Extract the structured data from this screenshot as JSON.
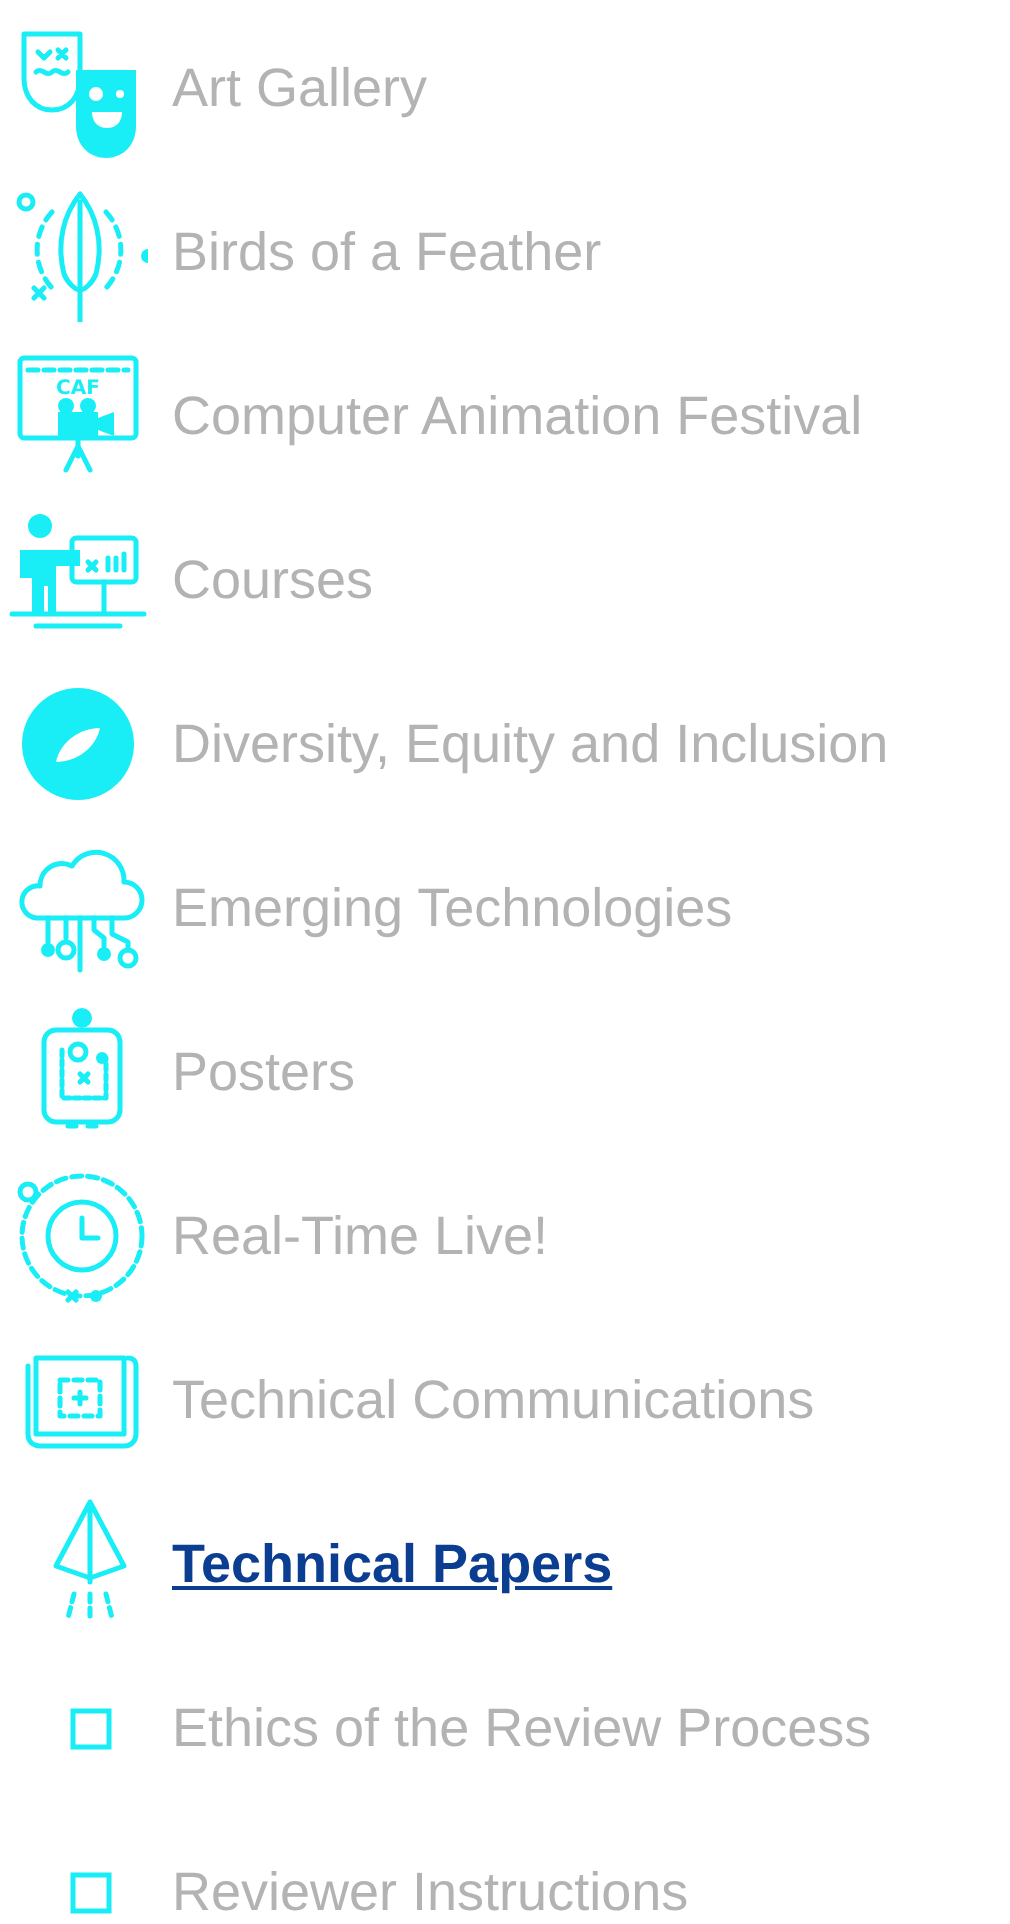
{
  "menu": [
    {
      "label": "Art Gallery",
      "kind": "section",
      "selected": false
    },
    {
      "label": "Birds of a Feather",
      "kind": "section",
      "selected": false
    },
    {
      "label": "Computer Animation Festival",
      "kind": "section",
      "icon_text": "CAF",
      "selected": false
    },
    {
      "label": "Courses",
      "kind": "section",
      "selected": false
    },
    {
      "label": "Diversity, Equity and Inclusion",
      "kind": "section",
      "selected": false
    },
    {
      "label": "Emerging Technologies",
      "kind": "section",
      "selected": false
    },
    {
      "label": "Posters",
      "kind": "section",
      "selected": false
    },
    {
      "label": "Real-Time Live!",
      "kind": "section",
      "selected": false
    },
    {
      "label": "Technical Communications",
      "kind": "section",
      "selected": false
    },
    {
      "label": "Technical Papers",
      "kind": "section",
      "selected": true
    },
    {
      "label": "Ethics of the Review Process",
      "kind": "subitem",
      "selected": false
    },
    {
      "label": "Reviewer Instructions",
      "kind": "subitem",
      "selected": false
    }
  ]
}
